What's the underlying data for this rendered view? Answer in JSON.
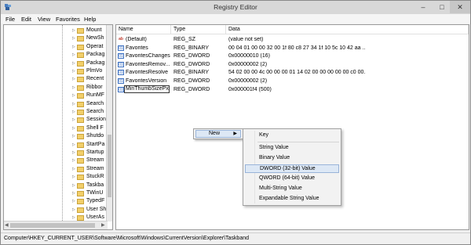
{
  "window": {
    "title": "Registry Editor",
    "minimize_glyph": "–",
    "maximize_glyph": "□",
    "close_glyph": "✕",
    "icon": "registry-editor-icon"
  },
  "menubar": {
    "items": [
      "File",
      "Edit",
      "View",
      "Favorites",
      "Help"
    ]
  },
  "tree": {
    "items": [
      "Mount",
      "NewSh",
      "Operat",
      "Packag",
      "Packag",
      "PlmVo",
      "Recent",
      "Ribbor",
      "RunMF",
      "Search",
      "Search",
      "Session",
      "Shell F",
      "Shutdo",
      "StartPa",
      "Startup",
      "Stream",
      "Stream",
      "StuckR",
      "Taskba",
      "TWinU",
      "TypedF",
      "User Sh",
      "UserAs"
    ],
    "expander_glyph": "▷",
    "folder_icon": "folder-icon"
  },
  "values": {
    "headers": {
      "name": "Name",
      "type": "Type",
      "data": "Data"
    },
    "rows": [
      {
        "icon": "string-value-icon",
        "glyph": "ab",
        "name": "(Default)",
        "type": "REG_SZ",
        "data": "(value not set)"
      },
      {
        "icon": "binary-value-icon",
        "glyph": "01",
        "name": "Favorites",
        "type": "REG_BINARY",
        "data": "00 04 01 00 00 32 00 1f 80 c8 27 34 1f 10 5c 10 42 aa ..."
      },
      {
        "icon": "binary-value-icon",
        "glyph": "01",
        "name": "FavoritesChanges",
        "type": "REG_DWORD",
        "data": "0x00000010 (16)"
      },
      {
        "icon": "binary-value-icon",
        "glyph": "01",
        "name": "FavoritesRemov...",
        "type": "REG_DWORD",
        "data": "0x00000002 (2)"
      },
      {
        "icon": "binary-value-icon",
        "glyph": "01",
        "name": "FavoritesResolve",
        "type": "REG_BINARY",
        "data": "54 02 00 00 4c 00 00 00 01 14 02 00 00 00 00 00 c0 00..."
      },
      {
        "icon": "binary-value-icon",
        "glyph": "01",
        "name": "FavoritesVersion",
        "type": "REG_DWORD",
        "data": "0x00000002 (2)"
      },
      {
        "icon": "binary-value-icon",
        "glyph": "01",
        "name": "MinThumbSizePx",
        "type": "REG_DWORD",
        "data": "0x000001f4 (500)"
      }
    ]
  },
  "context_menu": {
    "new_label": "New",
    "arrow": "▶"
  },
  "submenu": {
    "items": [
      "Key",
      "String Value",
      "Binary Value",
      "DWORD (32-bit) Value",
      "QWORD (64-bit) Value",
      "Multi-String Value",
      "Expandable String Value"
    ],
    "highlighted": "DWORD (32-bit) Value"
  },
  "statusbar": {
    "path": "Computer\\HKEY_CURRENT_USER\\Software\\Microsoft\\Windows\\CurrentVersion\\Explorer\\Taskband"
  },
  "colors": {
    "highlight_bg": "#dde8f5",
    "highlight_border": "#99b4d9",
    "folder": "#f2cf6a"
  }
}
